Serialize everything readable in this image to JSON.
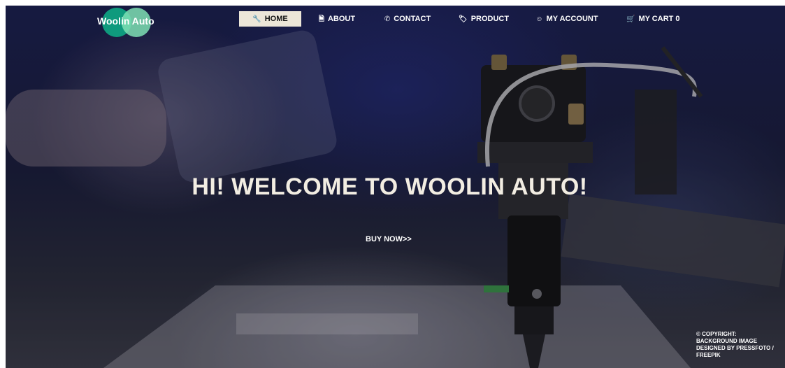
{
  "brand": {
    "name": "Woolin Auto"
  },
  "nav": [
    {
      "label": "HOME",
      "icon": "wrench-icon",
      "glyph": "🔧",
      "active": true
    },
    {
      "label": "ABOUT",
      "icon": "file-icon",
      "glyph": "🗎",
      "active": false
    },
    {
      "label": "CONTACT",
      "icon": "phone-icon",
      "glyph": "✆",
      "active": false
    },
    {
      "label": "PRODUCT",
      "icon": "tag-icon",
      "glyph": "🏷",
      "active": false
    },
    {
      "label": "MY ACCOUNT",
      "icon": "user-icon",
      "glyph": "☺",
      "active": false
    },
    {
      "label": "MY CART 0",
      "icon": "basket-icon",
      "glyph": "🛒",
      "active": false
    }
  ],
  "hero": {
    "headline": "HI! WELCOME TO WOOLIN AUTO!",
    "cta": "BUY NOW>>"
  },
  "footer": {
    "copyright": "© COPYRIGHT: BACKGROUND IMAGE DESIGNED BY PRESSFOTO / FREEPIK"
  },
  "colors": {
    "nav_active_bg": "#ece6d8",
    "headline": "#f2ede2",
    "logo_teal": "#0f9a7d",
    "logo_mint": "#7fe0b4"
  }
}
